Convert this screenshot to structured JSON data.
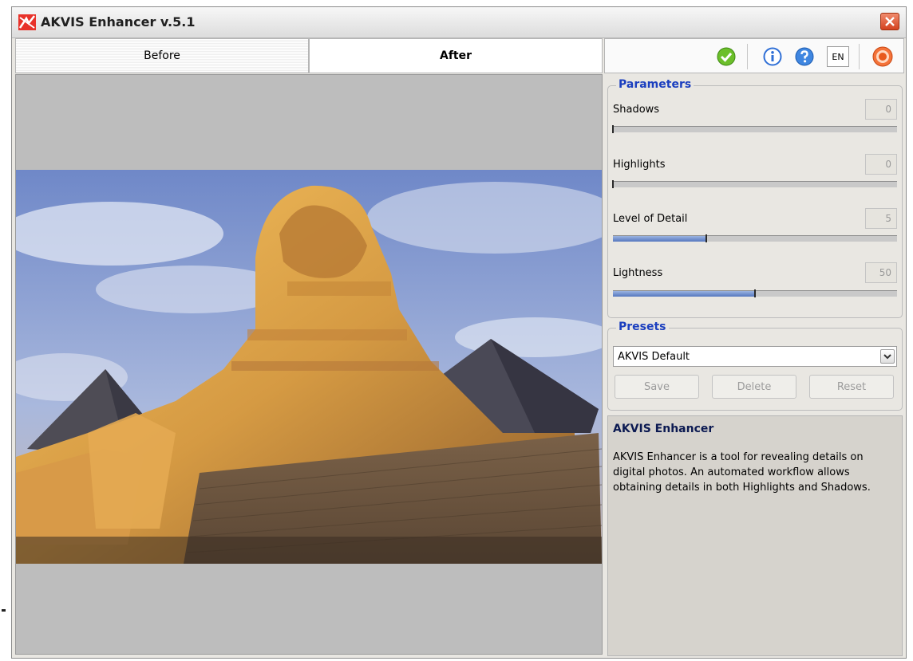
{
  "window": {
    "title": "AKVIS Enhancer v.5.1"
  },
  "tabs": [
    {
      "label": "Before",
      "active": false
    },
    {
      "label": "After",
      "active": true
    }
  ],
  "toolbar": {
    "run_icon": "green-check-icon",
    "info_icon": "info-icon",
    "help_icon": "help-icon",
    "language": "EN",
    "exit_icon": "power-icon"
  },
  "parameters": {
    "title": "Parameters",
    "items": [
      {
        "label": "Shadows",
        "value": "0",
        "fraction": 0.0
      },
      {
        "label": "Highlights",
        "value": "0",
        "fraction": 0.0
      },
      {
        "label": "Level of Detail",
        "value": "5",
        "fraction": 0.33
      },
      {
        "label": "Lightness",
        "value": "50",
        "fraction": 0.5
      }
    ]
  },
  "presets": {
    "title": "Presets",
    "selected": "AKVIS Default",
    "save_label": "Save",
    "delete_label": "Delete",
    "reset_label": "Reset"
  },
  "info": {
    "title": "AKVIS Enhancer",
    "text": "AKVIS Enhancer is a tool for revealing details on digital photos. An automated workflow allows obtaining details in both Highlights and Shadows."
  },
  "colors": {
    "accent": "#1b3fbf",
    "slider_fill": "#5577bf",
    "canvas_bg": "#bdbdbd"
  }
}
